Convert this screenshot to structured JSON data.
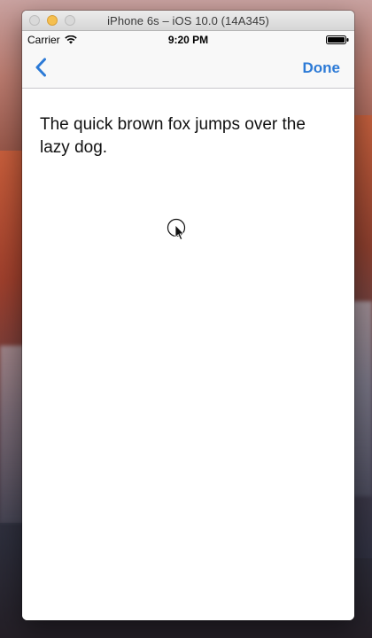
{
  "window": {
    "title": "iPhone 6s – iOS 10.0 (14A345)"
  },
  "status_bar": {
    "carrier": "Carrier",
    "time": "9:20 PM",
    "wifi_icon": "wifi-icon",
    "battery_icon": "battery-icon"
  },
  "nav_bar": {
    "back_icon": "chevron-left-icon",
    "done_label": "Done"
  },
  "content": {
    "text": "The quick brown fox jumps over the lazy dog."
  },
  "colors": {
    "accent": "#2c7ad6",
    "bar_background": "#f8f8f8",
    "text": "#111111"
  }
}
